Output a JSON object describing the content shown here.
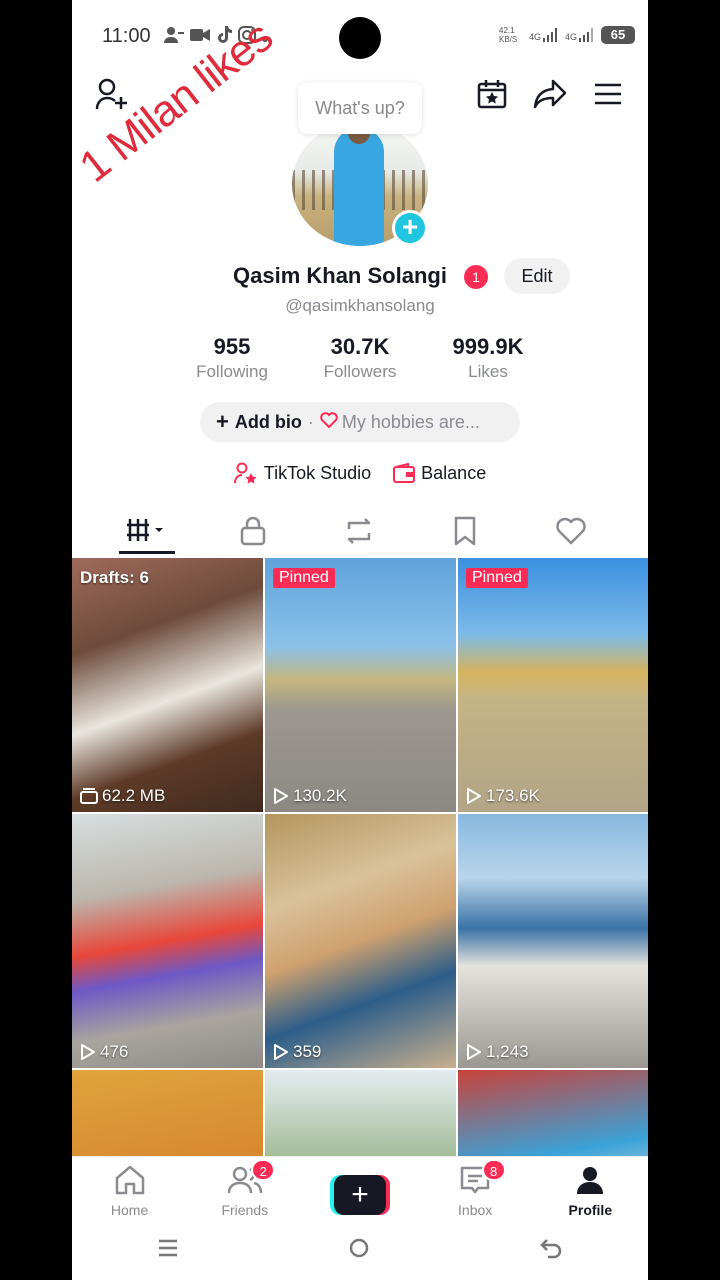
{
  "status_bar": {
    "time": "11:00",
    "net_speed": "42.1 KB/S",
    "signal1": "4G",
    "signal2": "4G",
    "battery": "65"
  },
  "overlay_text": "1 Milan likes",
  "whats_up": "What's up?",
  "profile": {
    "name": "Qasim Khan Solangi",
    "name_badge": "1",
    "edit_label": "Edit",
    "handle": "@qasimkhansolang"
  },
  "stats": [
    {
      "value": "955",
      "label": "Following"
    },
    {
      "value": "30.7K",
      "label": "Followers"
    },
    {
      "value": "999.9K",
      "label": "Likes"
    }
  ],
  "bio": {
    "add_label": "Add bio",
    "separator": "·",
    "hobbies_placeholder": "My hobbies are..."
  },
  "links": {
    "studio": "TikTok Studio",
    "balance": "Balance"
  },
  "grid": [
    {
      "top_label": "Drafts: 6",
      "bottom_label": "62.2 MB"
    },
    {
      "top_label": "Pinned",
      "bottom_label": "130.2K"
    },
    {
      "top_label": "Pinned",
      "bottom_label": "173.6K"
    },
    {
      "top_label": "",
      "bottom_label": "476"
    },
    {
      "top_label": "",
      "bottom_label": "359"
    },
    {
      "top_label": "",
      "bottom_label": "1,243"
    }
  ],
  "bottom_nav": {
    "home": "Home",
    "friends": "Friends",
    "friends_count": "2",
    "inbox": "Inbox",
    "inbox_count": "8",
    "profile": "Profile"
  },
  "colors": {
    "brand_red": "#fe2c55",
    "brand_cyan": "#25f4ee",
    "text_primary": "#161823",
    "text_secondary": "#8a8b91"
  }
}
